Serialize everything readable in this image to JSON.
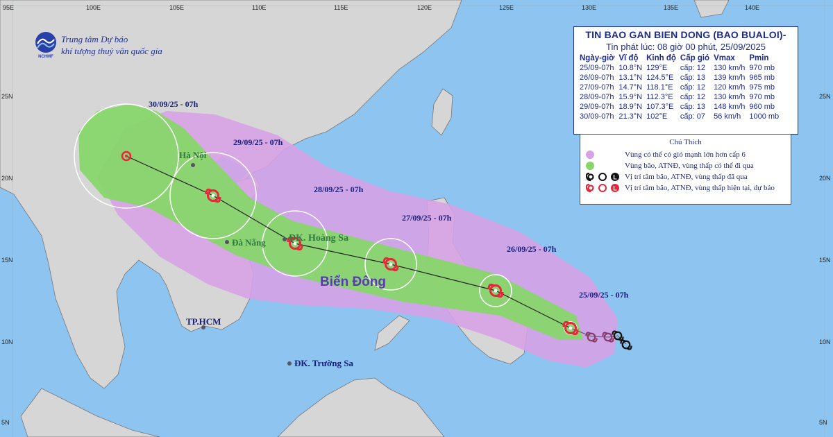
{
  "organization": {
    "line1": "Trung tâm Dự báo",
    "line2": "khí tượng thuỷ văn quốc gia",
    "logo_text": "NCHMF"
  },
  "info_box": {
    "title": "TIN BAO GAN BIEN DONG (BAO BUALOI)-",
    "subtitle": "Tin phát lúc: 08 giờ 00 phút, 25/09/2025",
    "columns": [
      "Ngày-giờ",
      "Vĩ độ",
      "Kinh độ",
      "Cấp gió",
      "Vmax",
      "Pmin"
    ],
    "rows": [
      [
        "25/09-07h",
        "10.8°N",
        "129°E",
        "cấp: 12",
        "130 km/h",
        "970 mb"
      ],
      [
        "26/09-07h",
        "13.1°N",
        "124.5°E",
        "cấp: 13",
        "139 km/h",
        "965 mb"
      ],
      [
        "27/09-07h",
        "14.7°N",
        "118.1°E",
        "cấp: 12",
        "120 km/h",
        "975 mb"
      ],
      [
        "28/09-07h",
        "15.9°N",
        "112.3°E",
        "cấp: 12",
        "130 km/h",
        "970 mb"
      ],
      [
        "29/09-07h",
        "18.9°N",
        "107.3°E",
        "cấp: 13",
        "148 km/h",
        "960 mb"
      ],
      [
        "30/09-07h",
        "21.3°N",
        "102°E",
        "cấp: 07",
        "56 km/h",
        "1000 mb"
      ]
    ]
  },
  "legend": {
    "title": "Chú Thích",
    "items": [
      {
        "label": "Vùng có thể có gió mạnh lớn hơn cấp 6",
        "icon": "violet-dot"
      },
      {
        "label": "Vùng bão, ATNĐ, vùng thấp có thể đi qua",
        "icon": "green-dot"
      },
      {
        "label": "Vị trí tâm bão, ATNĐ, vùng thấp đã qua",
        "icon": "past-symbols",
        "letters": [
          "O",
          "L"
        ]
      },
      {
        "label": "Vị trí tâm bão, ATNĐ, vùng thấp hiện tại, dự báo",
        "icon": "forecast-symbols",
        "letters": [
          "O",
          "L"
        ]
      }
    ]
  },
  "axes": {
    "lon_ticks": [
      "95E",
      "100E",
      "105E",
      "110E",
      "115E",
      "120E",
      "125E",
      "130E",
      "135E",
      "140E"
    ],
    "lat_ticks": [
      "25N",
      "20N",
      "15N",
      "10N",
      "5N"
    ]
  },
  "date_labels": [
    "30/09/25 - 07h",
    "29/09/25 - 07h",
    "28/09/25 - 07h",
    "27/09/25 - 07h",
    "26/09/25 - 07h",
    "25/09/25 - 07h"
  ],
  "places": {
    "hanoi": "Hà Nội",
    "danang": "Đà Nẵng",
    "hoangsa": "ĐK. Hoàng Sa",
    "hcm": "TP.HCM",
    "truongsa": "ĐK. Trường Sa",
    "sea": "Biển Đông"
  },
  "colors": {
    "sea": "#8ec4f0",
    "land": "#d6d6d6",
    "wind_zone": "#d7a2e6",
    "storm_zone": "#86d768",
    "storm_symbol": "#e8263a",
    "text_navy": "#1d2b8f"
  }
}
